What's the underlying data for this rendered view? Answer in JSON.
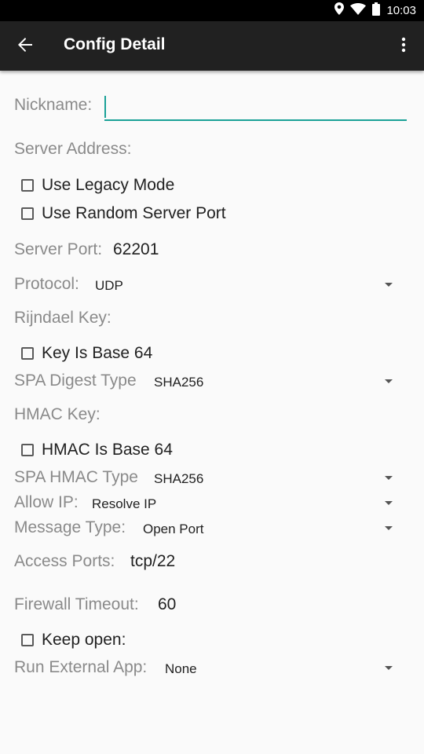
{
  "status_bar": {
    "time": "10:03",
    "icons": [
      "location-icon",
      "wifi-icon",
      "battery-icon"
    ]
  },
  "app_bar": {
    "title": "Config Detail",
    "back_icon": "arrow-back-icon",
    "menu_icon": "more-vert-icon"
  },
  "form": {
    "nickname": {
      "label": "Nickname:",
      "value": ""
    },
    "server_address": {
      "label": "Server Address:"
    },
    "use_legacy_mode": {
      "label": "Use Legacy Mode",
      "checked": false
    },
    "use_random_port": {
      "label": "Use Random Server Port",
      "checked": false
    },
    "server_port": {
      "label": "Server Port:",
      "value": "62201"
    },
    "protocol": {
      "label": "Protocol:",
      "value": "UDP"
    },
    "rijndael_key": {
      "label": "Rijndael Key:"
    },
    "key_is_base64": {
      "label": "Key Is Base 64",
      "checked": false
    },
    "spa_digest_type": {
      "label": "SPA Digest Type",
      "value": "SHA256"
    },
    "hmac_key": {
      "label": "HMAC Key:"
    },
    "hmac_is_base64": {
      "label": "HMAC Is Base 64",
      "checked": false
    },
    "spa_hmac_type": {
      "label": "SPA HMAC Type",
      "value": "SHA256"
    },
    "allow_ip": {
      "label": "Allow IP:",
      "value": "Resolve IP"
    },
    "message_type": {
      "label": "Message Type:",
      "value": "Open Port"
    },
    "access_ports": {
      "label": "Access Ports:",
      "value": "tcp/22"
    },
    "firewall_timeout": {
      "label": "Firewall Timeout:",
      "value": "60"
    },
    "keep_open": {
      "label": "Keep open:",
      "checked": false
    },
    "run_external_app": {
      "label": "Run External App:",
      "value": "None"
    }
  },
  "colors": {
    "accent": "#1aa197",
    "app_bar": "#212121",
    "status_bar": "#000000",
    "background": "#fafafa",
    "label": "#8a8a8a"
  }
}
